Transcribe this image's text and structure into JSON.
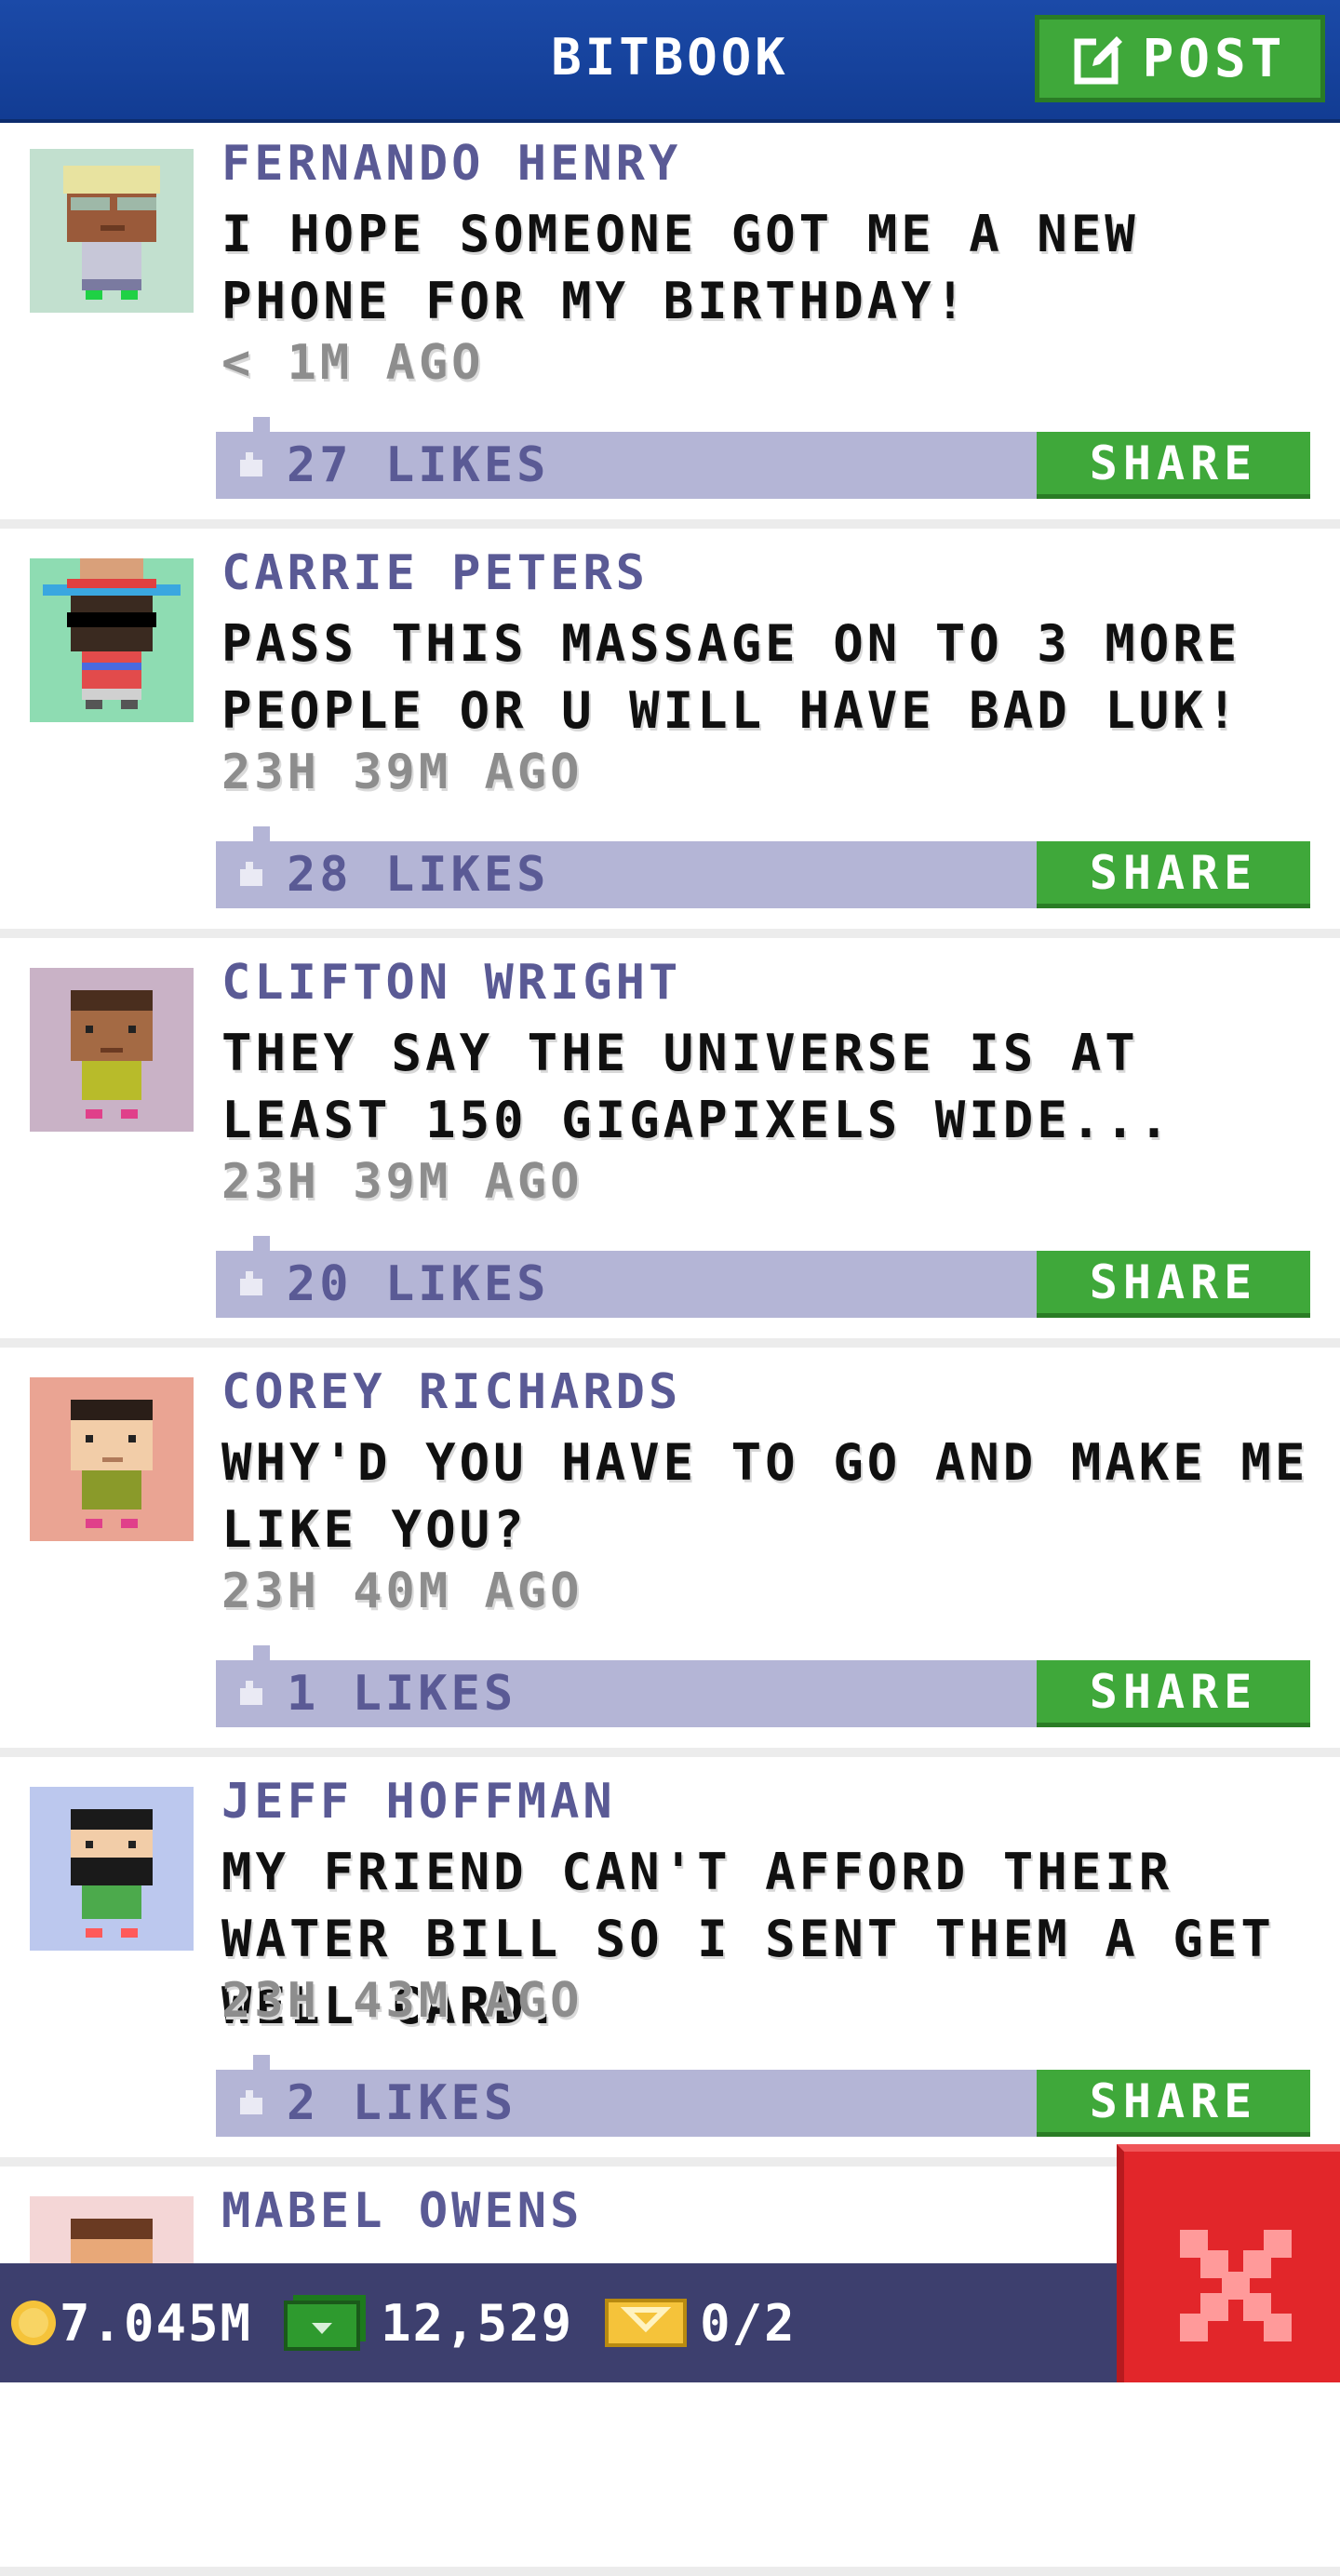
{
  "header": {
    "title": "BITBOOK",
    "post_label": "POST"
  },
  "posts": [
    {
      "author": "FERNANDO HENRY",
      "message": "I HOPE SOMEONE GOT ME A NEW PHONE FOR MY BIRTHDAY!",
      "time": "< 1M AGO",
      "likes": "27 LIKES",
      "share": "SHARE",
      "avatar_bg": "#c2e0cf"
    },
    {
      "author": "CARRIE PETERS",
      "message": "PASS THIS MASSAGE ON TO 3 MORE PEOPLE OR U WILL HAVE BAD LUK!",
      "time": "23H 39M AGO",
      "likes": "28 LIKES",
      "share": "SHARE",
      "avatar_bg": "#8edcb2"
    },
    {
      "author": "CLIFTON WRIGHT",
      "message": "THEY SAY THE UNIVERSE IS AT LEAST 150 GIGAPIXELS WIDE...",
      "time": "23H 39M AGO",
      "likes": "20 LIKES",
      "share": "SHARE",
      "avatar_bg": "#c9b2c6"
    },
    {
      "author": "COREY RICHARDS",
      "message": "WHY'D YOU HAVE TO GO AND MAKE ME LIKE YOU?",
      "time": "23H 40M AGO",
      "likes": "1 LIKES",
      "share": "SHARE",
      "avatar_bg": "#eaa493"
    },
    {
      "author": "JEFF HOFFMAN",
      "message": "MY FRIEND CAN'T AFFORD THEIR WATER BILL SO I SENT THEM A GET WELL CARD.",
      "time": "23H 43M AGO",
      "likes": "2 LIKES",
      "share": "SHARE",
      "avatar_bg": "#bcc8ee"
    },
    {
      "author": "MABEL OWENS",
      "message": "",
      "time": "",
      "likes": "",
      "share": "",
      "avatar_bg": "#f4d6d6"
    }
  ],
  "status": {
    "coins": "7.045M",
    "bux": "12,529",
    "tickets": "0/2"
  },
  "colors": {
    "header_blue": "#1b4aa8",
    "share_green": "#3fa83a",
    "likes_bar": "#b4b5d6",
    "status_bar": "#3d3f6e",
    "close_red": "#e2262a"
  },
  "icons": {
    "post": "edit-icon",
    "like": "thumbs-up-icon",
    "coin": "coin-icon",
    "bux": "bux-icon",
    "ticket": "ticket-icon",
    "close": "close-icon"
  }
}
